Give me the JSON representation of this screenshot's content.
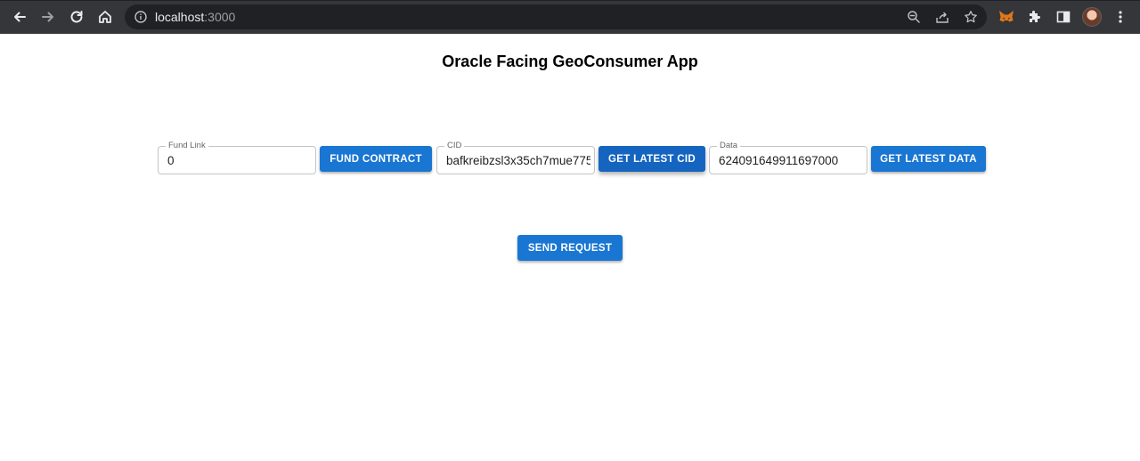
{
  "browser": {
    "url_host": "localhost",
    "url_port": ":3000",
    "icons": [
      "back-icon",
      "forward-icon",
      "reload-icon",
      "home-icon",
      "info-icon",
      "zoom-icon",
      "share-icon",
      "star-icon",
      "metamask-icon",
      "extensions-icon",
      "sidepanel-icon",
      "profile-avatar",
      "menu-icon"
    ]
  },
  "page": {
    "title": "Oracle Facing GeoConsumer App"
  },
  "fund": {
    "label": "Fund Link",
    "value": "0",
    "button": "FUND CONTRACT"
  },
  "cid": {
    "label": "CID",
    "value": "bafkreibzsl3x35ch7mue775",
    "button": "GET LATEST CID"
  },
  "data_field": {
    "label": "Data",
    "value": "624091649911697000",
    "button": "GET LATEST DATA"
  },
  "send": {
    "button": "SEND REQUEST"
  },
  "colors": {
    "primary": "#1976d2",
    "primary_dark": "#1565c0",
    "chrome_bg": "#35363a",
    "omnibox_bg": "#202124"
  }
}
